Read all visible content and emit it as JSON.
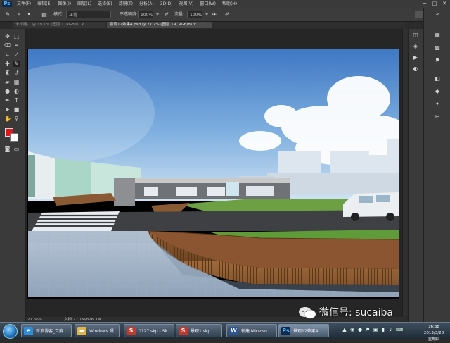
{
  "app": {
    "icon_label": "Ps"
  },
  "menubar": {
    "items": [
      "文件(F)",
      "编辑(E)",
      "图像(I)",
      "图层(L)",
      "选择(S)",
      "滤镜(T)",
      "分析(A)",
      "3D(D)",
      "视图(V)",
      "窗口(W)",
      "帮助(H)"
    ],
    "window_controls": [
      "─",
      "□",
      "✕"
    ]
  },
  "options_bar": {
    "mode_label": "模式:",
    "mode_value": "正常",
    "opacity_label": "不透明度:",
    "opacity_value": "100%",
    "flow_label": "流量:",
    "flow_value": "100%"
  },
  "tabs": [
    {
      "label": "未标题-1 @ 19.1% (图层 1, RGB/8) ×",
      "active": false
    },
    {
      "label": "景观12效果4.psd @ 27.7% (图层 19, RGB/8) ×",
      "active": true
    }
  ],
  "status": {
    "zoom": "27.66%",
    "doc": "文档:27.7M/826.3M"
  },
  "watermark": {
    "text": "微信号: sucaiba"
  },
  "taskbar": {
    "tasks": [
      {
        "label": "新浪博客_百度..."
      },
      {
        "label": "Windows 照..."
      },
      {
        "label": "0127.skp - Sk..."
      },
      {
        "label": "景观1.skp..."
      },
      {
        "label": "新建 Microso..."
      },
      {
        "label": "景观12效果4..."
      }
    ],
    "clock_time": "16:38",
    "clock_date": "2013/3/28 星期四"
  },
  "colors": {
    "foreground": "#e3161b",
    "background": "#ffffff",
    "ui_dark": "#2b2b2b",
    "ui_panel": "#3a3a3a"
  },
  "icons": {
    "tools": [
      "move",
      "marquee",
      "lasso",
      "quick-select",
      "crop",
      "eyedropper",
      "healing",
      "brush",
      "clone-stamp",
      "history-brush",
      "eraser",
      "gradient",
      "blur",
      "dodge",
      "pen",
      "type",
      "path-select",
      "shape",
      "hand",
      "zoom",
      "3d-rotate",
      "quick-mask",
      "screen-mode"
    ]
  }
}
